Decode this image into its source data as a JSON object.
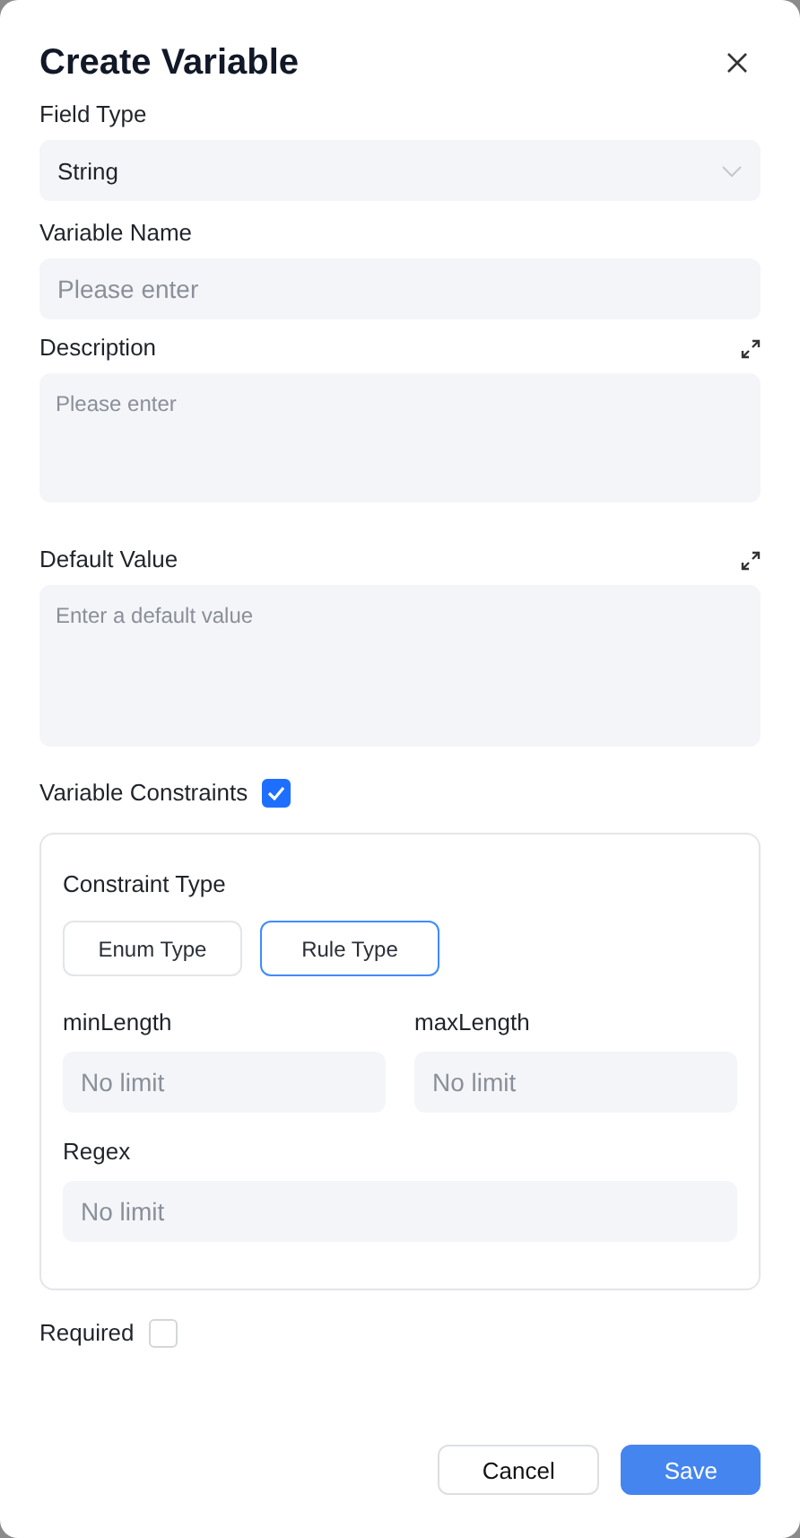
{
  "dialog": {
    "title": "Create Variable"
  },
  "fields": [
    {
      "kind": "select",
      "label": "Field Type",
      "value": "String"
    },
    {
      "kind": "input",
      "label": "Variable Name",
      "placeholder": "Please enter"
    },
    {
      "kind": "textarea",
      "label": "Description",
      "placeholder": "Please enter"
    },
    {
      "kind": "textarea",
      "label": "Default Value",
      "placeholder": "Enter a default value"
    }
  ],
  "constraints": {
    "label": "Variable Constraints",
    "checked": true,
    "type_label": "Constraint Type",
    "types": [
      {
        "label": "Enum Type",
        "selected": false
      },
      {
        "label": "Rule Type",
        "selected": true
      }
    ],
    "rules": [
      {
        "label": "minLength",
        "placeholder": "No limit"
      },
      {
        "label": "maxLength",
        "placeholder": "No limit"
      },
      {
        "label": "Regex",
        "placeholder": "No limit"
      }
    ]
  },
  "required": {
    "label": "Required",
    "checked": false
  },
  "buttons": [
    {
      "label": "Cancel",
      "kind": "secondary"
    },
    {
      "label": "Save",
      "kind": "primary"
    }
  ]
}
